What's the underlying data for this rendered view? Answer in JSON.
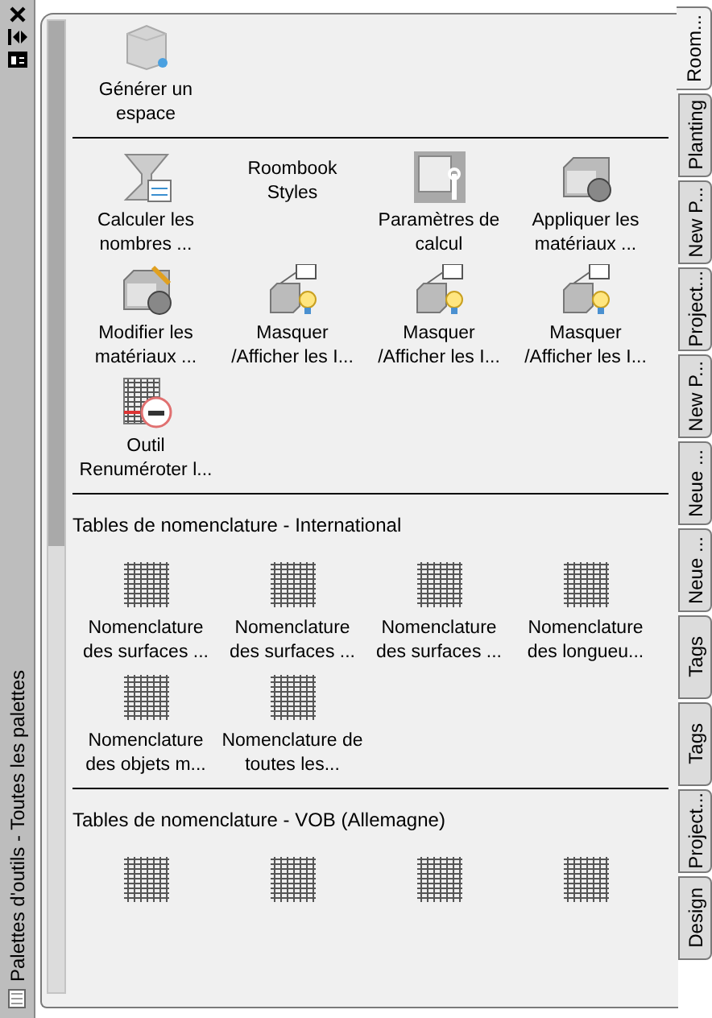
{
  "side_strip": {
    "title": "Palettes d'outils - Toutes les palettes"
  },
  "sections": [
    {
      "tools": [
        {
          "kind": "space",
          "label": "Générer un espace"
        }
      ]
    },
    {
      "tools": [
        {
          "kind": "calc",
          "label": "Calculer les nombres ..."
        },
        {
          "kind": "blank",
          "label": "Roombook Styles"
        },
        {
          "kind": "settings",
          "label": "Paramètres de calcul"
        },
        {
          "kind": "material",
          "label": "Appliquer les matériaux ..."
        },
        {
          "kind": "material-edit",
          "label": "Modifier les matériaux ..."
        },
        {
          "kind": "visibility",
          "label": "Masquer /Afficher les I..."
        },
        {
          "kind": "visibility",
          "label": "Masquer /Afficher les I..."
        },
        {
          "kind": "visibility",
          "label": "Masquer /Afficher les I..."
        },
        {
          "kind": "renumber",
          "label": "Outil Renuméroter l..."
        }
      ]
    },
    {
      "title": "Tables de nomenclature - International",
      "tools": [
        {
          "kind": "schedule",
          "label": "Nomenclature des surfaces ..."
        },
        {
          "kind": "schedule",
          "label": "Nomenclature des surfaces ..."
        },
        {
          "kind": "schedule",
          "label": "Nomenclature des surfaces ..."
        },
        {
          "kind": "schedule",
          "label": "Nomenclature des longueu..."
        },
        {
          "kind": "schedule",
          "label": "Nomenclature des objets m..."
        },
        {
          "kind": "schedule",
          "label": "Nomenclature de toutes les..."
        }
      ]
    },
    {
      "title": "Tables de nomenclature - VOB (Allemagne)",
      "tools": [
        {
          "kind": "schedule"
        },
        {
          "kind": "schedule"
        },
        {
          "kind": "schedule"
        },
        {
          "kind": "schedule"
        }
      ]
    }
  ],
  "tabs": [
    {
      "label": "Room...",
      "selected": true
    },
    {
      "label": "Planting",
      "selected": false
    },
    {
      "label": "New P...",
      "selected": false
    },
    {
      "label": "Project...",
      "selected": false
    },
    {
      "label": "New P...",
      "selected": false
    },
    {
      "label": "Neue ...",
      "selected": false
    },
    {
      "label": "Neue ...",
      "selected": false
    },
    {
      "label": "Tags",
      "selected": false
    },
    {
      "label": "Tags",
      "selected": false
    },
    {
      "label": "Project...",
      "selected": false
    },
    {
      "label": "Design",
      "selected": false
    }
  ]
}
